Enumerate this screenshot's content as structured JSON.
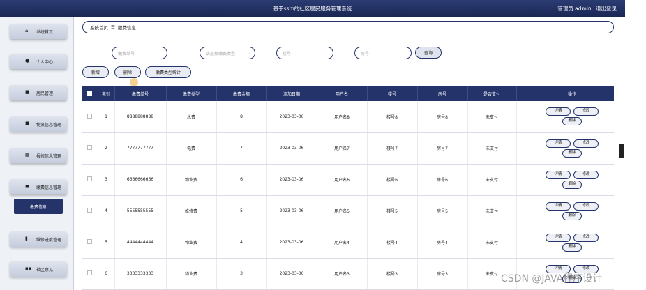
{
  "header": {
    "title": "基于ssm的社区居民服务管理系统",
    "user_label": "管理员 admin",
    "logout_label": "退出登录"
  },
  "sidebar": {
    "items": [
      {
        "label": "系统首页",
        "icon": "home-icon",
        "glyph": "⌂"
      },
      {
        "label": "个人中心",
        "icon": "user-icon",
        "glyph": "●"
      },
      {
        "label": "居民管理",
        "icon": "resident-icon",
        "glyph": "■"
      },
      {
        "label": "物资信息管理",
        "icon": "supplies-icon",
        "glyph": "■"
      },
      {
        "label": "报修信息管理",
        "icon": "repair-icon",
        "glyph": "▦"
      },
      {
        "label": "缴费信息管理",
        "icon": "payment-icon",
        "glyph": "▬"
      },
      {
        "label": "缴费信息",
        "icon": "",
        "glyph": "",
        "active": true
      },
      {
        "label": "维修进度管理",
        "icon": "progress-icon",
        "glyph": "▮"
      },
      {
        "label": "社区意见",
        "icon": "opinion-icon",
        "glyph": "▪▪"
      }
    ]
  },
  "breadcrumb": {
    "home": "系统首页",
    "separator": "☰",
    "current": "缴费信息"
  },
  "search": {
    "bill_no_placeholder": "缴费单号",
    "type_placeholder": "请选择缴费类型",
    "building_placeholder": "楼号",
    "room_placeholder": "房号",
    "query_label": "查询"
  },
  "toolbar": {
    "add_label": "新增",
    "delete_label": "删除",
    "stats_label": "缴费类型统计"
  },
  "table": {
    "headers": [
      "",
      "索引",
      "缴费单号",
      "缴费类型",
      "缴费金额",
      "添加日期",
      "用户名",
      "楼号",
      "房号",
      "是否支付",
      "操作"
    ],
    "actions": {
      "detail": "详情",
      "edit": "修改",
      "delete": "删除"
    },
    "rows": [
      {
        "index": "1",
        "bill_no": "8888888888",
        "type": "水费",
        "amount": "8",
        "date": "2023-03-06",
        "username": "用户名8",
        "building": "楼号8",
        "room": "房号8",
        "paid": "未支付"
      },
      {
        "index": "2",
        "bill_no": "7777777777",
        "type": "电费",
        "amount": "7",
        "date": "2023-03-06",
        "username": "用户名7",
        "building": "楼号7",
        "room": "房号7",
        "paid": "未支付"
      },
      {
        "index": "3",
        "bill_no": "6666666666",
        "type": "物业费",
        "amount": "6",
        "date": "2023-03-06",
        "username": "用户名6",
        "building": "楼号6",
        "room": "房号6",
        "paid": "未支付"
      },
      {
        "index": "4",
        "bill_no": "5555555555",
        "type": "维修费",
        "amount": "5",
        "date": "2023-03-06",
        "username": "用户名5",
        "building": "楼号5",
        "room": "房号5",
        "paid": "未支付"
      },
      {
        "index": "5",
        "bill_no": "4444444444",
        "type": "物业费",
        "amount": "4",
        "date": "2023-03-06",
        "username": "用户名4",
        "building": "楼号4",
        "room": "房号4",
        "paid": "未支付"
      },
      {
        "index": "6",
        "bill_no": "3333333333",
        "type": "物业费",
        "amount": "3",
        "date": "2023-03-06",
        "username": "用户名3",
        "building": "楼号3",
        "room": "房号3",
        "paid": "未支付"
      }
    ]
  },
  "watermark": "CSDN @JAVA程序设计",
  "colors": {
    "primary": "#24346b",
    "header_bg": "#1b2754",
    "sidebar_bg": "#eef1f6"
  }
}
